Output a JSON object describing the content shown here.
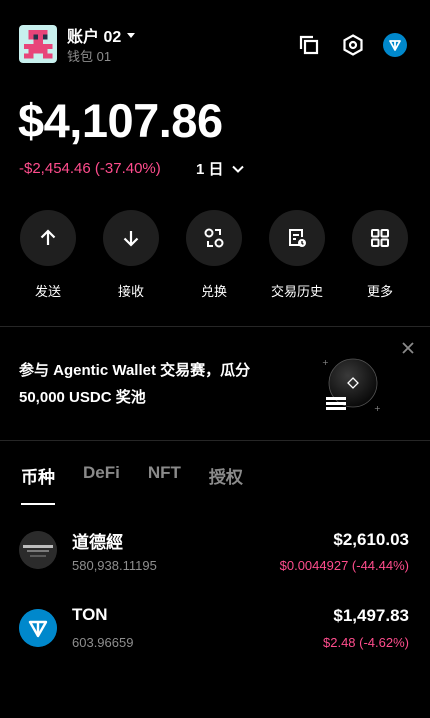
{
  "account": {
    "name": "账户 02",
    "wallet": "钱包 01"
  },
  "header_icons": [
    "copy-icon",
    "hexagon-settings-icon",
    "ton-network-icon"
  ],
  "balance": {
    "total": "$4,107.86",
    "change": "-$2,454.46 (-37.40%)",
    "period": "1 日"
  },
  "actions": [
    {
      "label": "发送",
      "icon": "arrow-up-icon"
    },
    {
      "label": "接收",
      "icon": "arrow-down-icon"
    },
    {
      "label": "兑换",
      "icon": "swap-icon"
    },
    {
      "label": "交易历史",
      "icon": "history-icon"
    },
    {
      "label": "更多",
      "icon": "grid-icon"
    }
  ],
  "banner": {
    "line1": "参与 Agentic Wallet 交易赛，瓜分",
    "line2": "50,000 USDC 奖池"
  },
  "tabs": [
    "币种",
    "DeFi",
    "NFT",
    "授权"
  ],
  "active_tab": "币种",
  "assets": [
    {
      "name": "道德經",
      "amount": "580,938.11195",
      "value": "$2,610.03",
      "change": "$0.0044927 (-44.44%)"
    },
    {
      "name": "TON",
      "amount": "603.96659",
      "value": "$1,497.83",
      "change": "$2.48 (-4.62%)"
    }
  ],
  "colors": {
    "accent_negative": "#ff4d8d",
    "ton_blue": "#0088cc",
    "background": "#000000"
  }
}
